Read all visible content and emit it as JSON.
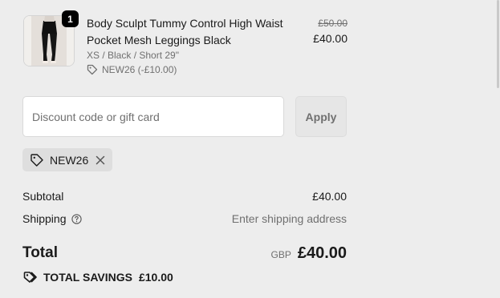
{
  "line_item": {
    "quantity": "1",
    "title": "Body Sculpt Tummy Control High Waist Pocket Mesh Leggings Black",
    "variant": "XS / Black / Short 29\"",
    "discount": "NEW26 (-£10.00)",
    "compare_price": "£50.00",
    "price": "£40.00",
    "image_icon": "leggings-product-photo"
  },
  "discount_form": {
    "placeholder": "Discount code or gift card",
    "value": "",
    "apply_label": "Apply"
  },
  "applied_code": {
    "code": "NEW26",
    "icon": "tag-icon",
    "remove_icon": "close-icon"
  },
  "summary": {
    "subtotal_label": "Subtotal",
    "subtotal_value": "£40.00",
    "shipping_label": "Shipping",
    "shipping_value": "Enter shipping address",
    "total_label": "Total",
    "currency": "GBP",
    "total_value": "£40.00",
    "savings_label": "TOTAL SAVINGS",
    "savings_value": "£10.00"
  },
  "colors": {
    "background": "#ededed",
    "text": "#1a1a1a",
    "muted": "#707070",
    "badge": "#000000"
  }
}
